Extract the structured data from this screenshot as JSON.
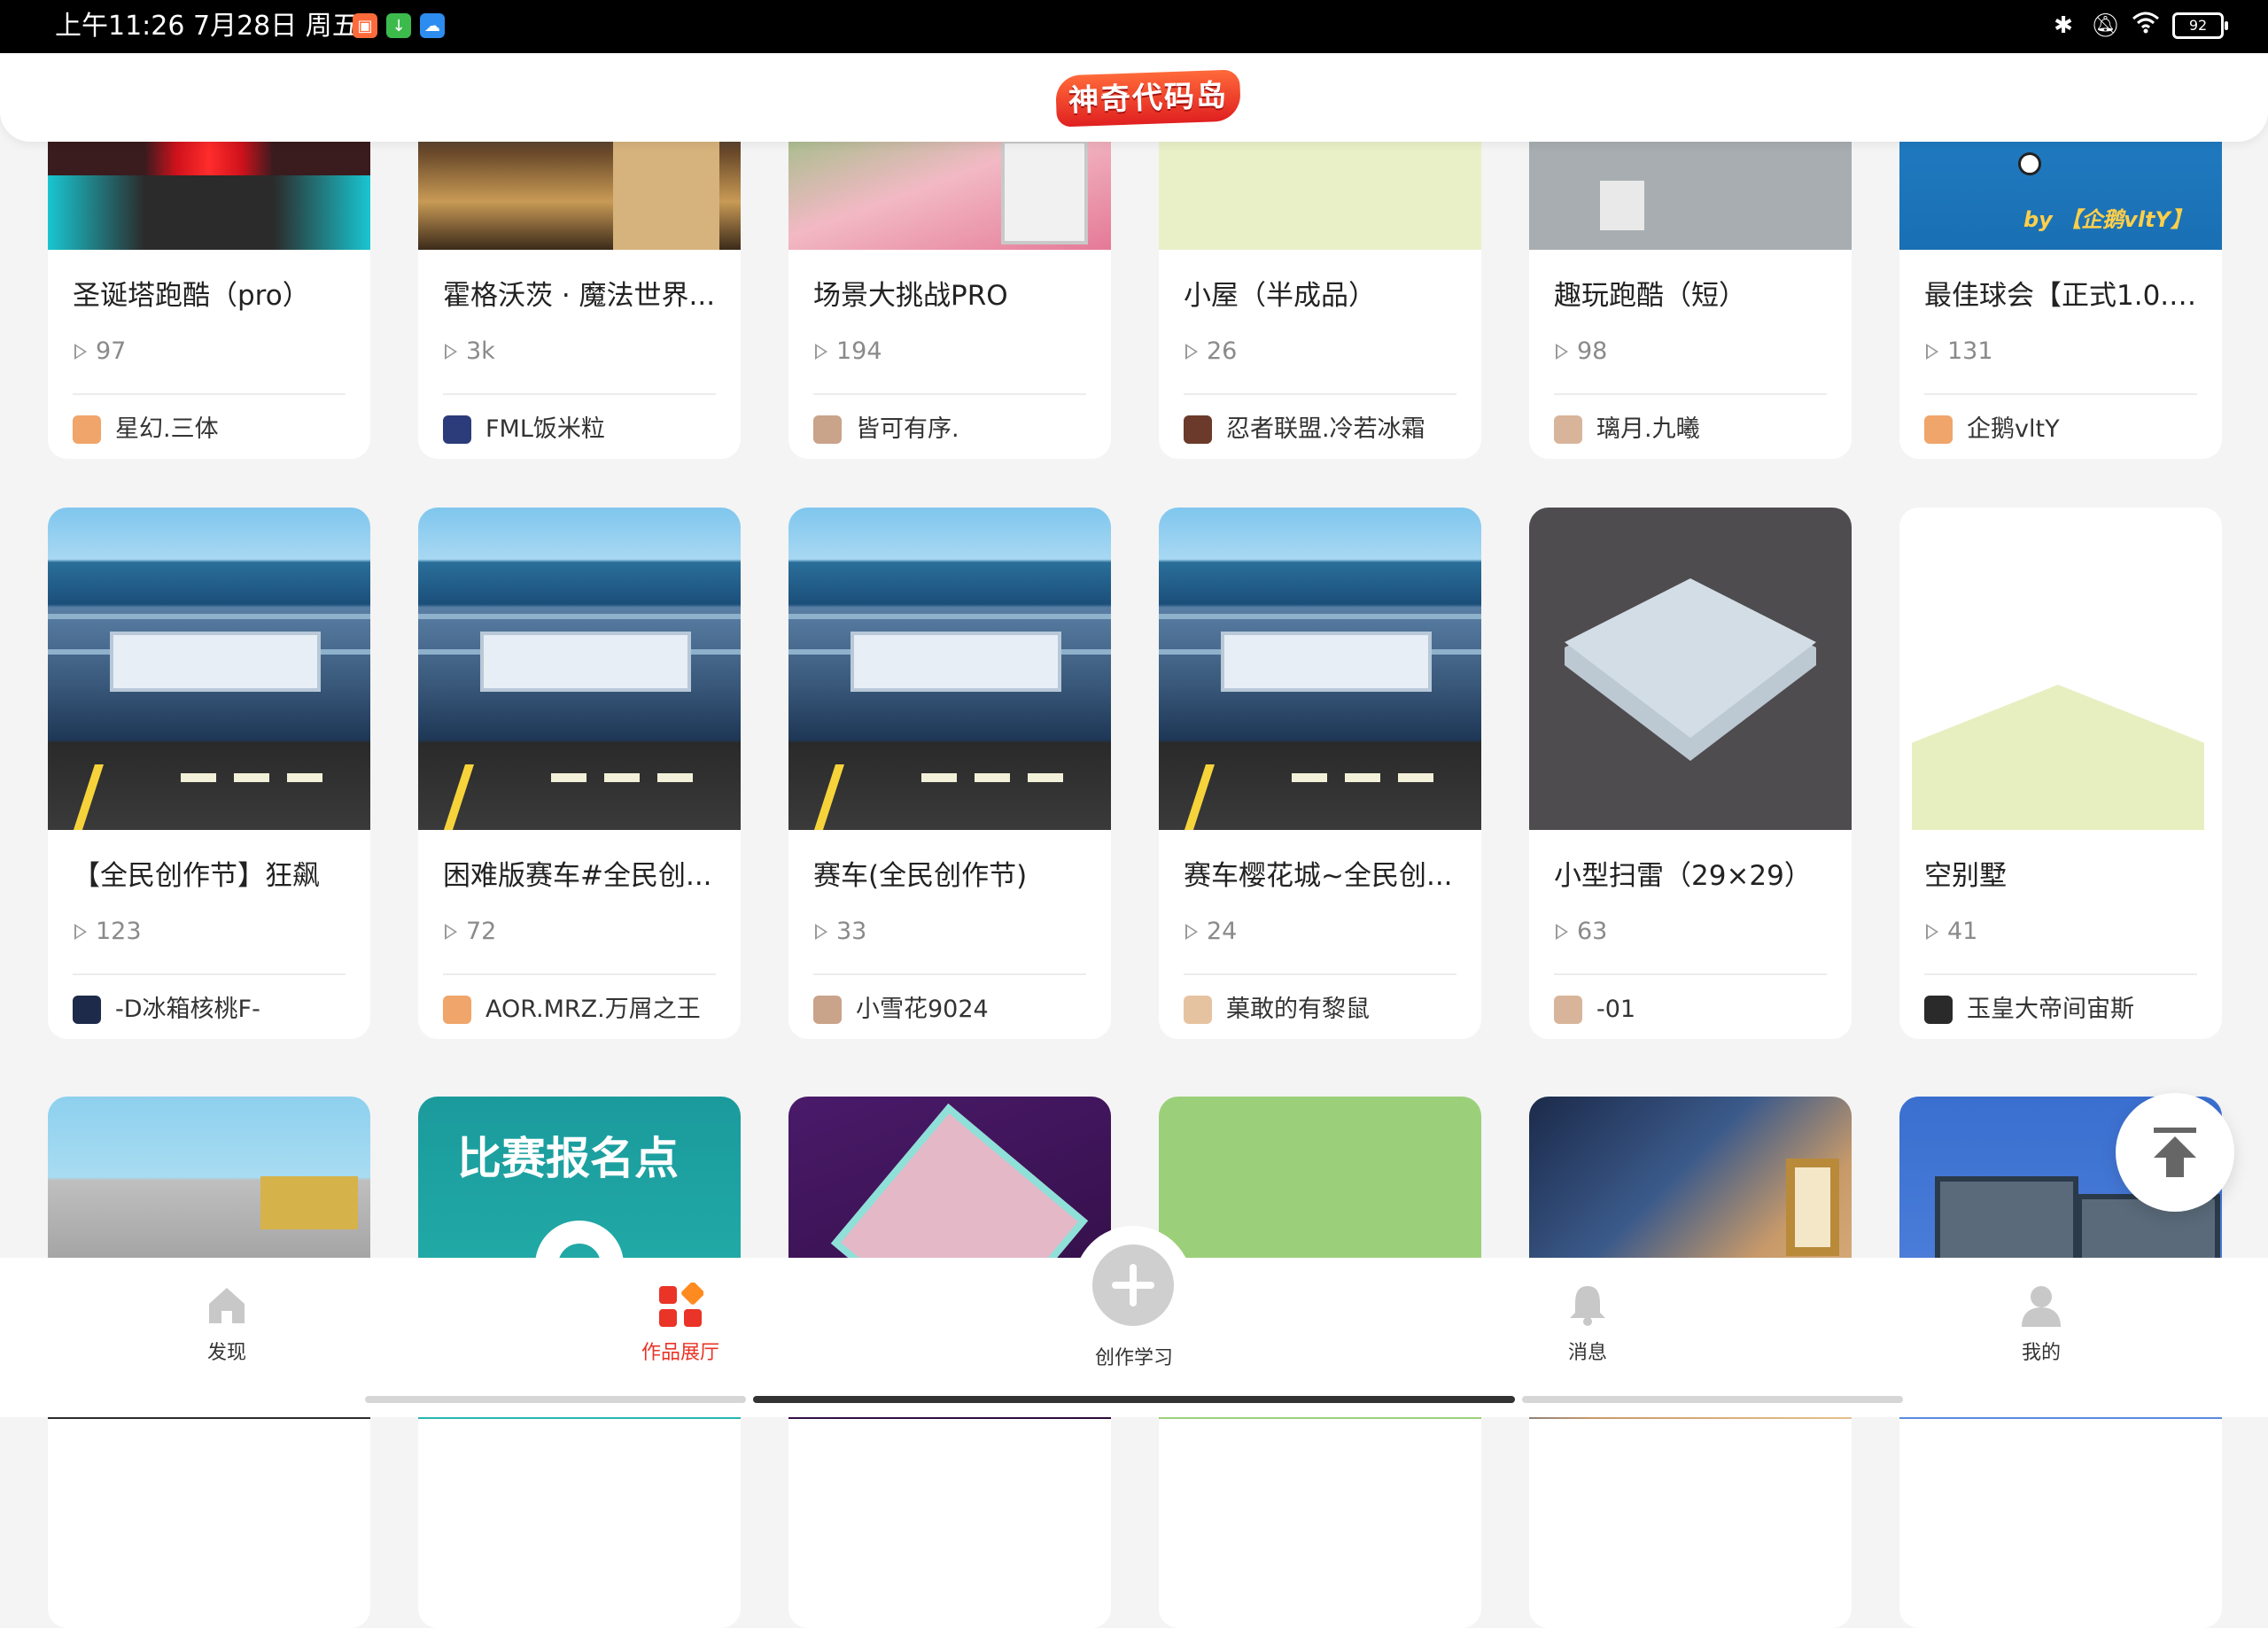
{
  "status_bar": {
    "time": "上午11:26 7月28日 周五",
    "battery": "92",
    "icons": [
      "bluetooth-icon",
      "mute-icon",
      "wifi-icon",
      "battery-icon"
    ]
  },
  "header": {
    "logo_text": "神奇代码岛"
  },
  "works": [
    {
      "title": "圣诞塔跑酷（pro）",
      "plays": "97",
      "author": "星幻.三体"
    },
    {
      "title": "霍格沃茨 · 魔法世界...",
      "plays": "3k",
      "author": "FML饭米粒"
    },
    {
      "title": "场景大挑战PRO",
      "plays": "194",
      "author": "皆可有序."
    },
    {
      "title": "小屋（半成品）",
      "plays": "26",
      "author": "忍者联盟.冷若冰霜"
    },
    {
      "title": "趣玩跑酷（短）",
      "plays": "98",
      "author": "璃月.九曦"
    },
    {
      "title": "最佳球会【正式1.0.0...",
      "plays": "131",
      "author": "企鹅vltY",
      "thumb_caption": "by 【企鹅vltY】"
    },
    {
      "title": "【全民创作节】狂飙",
      "plays": "123",
      "author": "-D冰箱核桃F-"
    },
    {
      "title": "困难版赛车#全民创...",
      "plays": "72",
      "author": "AOR.MRZ.万屑之王"
    },
    {
      "title": "赛车(全民创作节)",
      "plays": "33",
      "author": "小雪花9024"
    },
    {
      "title": "赛车樱花城~全民创...",
      "plays": "24",
      "author": "菓敢的有黎鼠"
    },
    {
      "title": "小型扫雷（29×29）",
      "plays": "63",
      "author": "-01"
    },
    {
      "title": "空别墅",
      "plays": "41",
      "author": "玉皇大帝间宙斯"
    },
    {
      "thumb_caption": "比赛报名点"
    }
  ],
  "bottom_nav": [
    {
      "label": "发现",
      "icon": "home-icon"
    },
    {
      "label": "作品展厅",
      "icon": "gallery-icon",
      "active": true
    },
    {
      "label": "创作学习",
      "icon": "plus-icon"
    },
    {
      "label": "消息",
      "icon": "bell-icon"
    },
    {
      "label": "我的",
      "icon": "user-icon"
    }
  ],
  "colors": {
    "accent": "#e93427",
    "background": "#f4f4f4"
  }
}
